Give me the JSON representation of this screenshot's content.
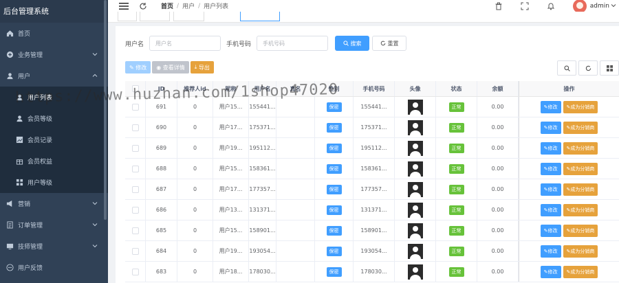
{
  "app": {
    "title": "后台管理系统"
  },
  "sidebar": {
    "items": [
      {
        "label": "首页",
        "icon": "home-icon",
        "expandable": false
      },
      {
        "label": "业务管理",
        "icon": "plus-circle-icon",
        "expandable": true
      },
      {
        "label": "用户",
        "icon": "user-icon",
        "expandable": true,
        "expanded": true
      },
      {
        "label": "用户列表",
        "icon": "user-icon",
        "sub": true,
        "active": true
      },
      {
        "label": "会员等级",
        "icon": "user-icon",
        "sub": true
      },
      {
        "label": "会员记录",
        "icon": "chart-icon",
        "sub": true
      },
      {
        "label": "会员权益",
        "icon": "gift-icon",
        "sub": true
      },
      {
        "label": "用户等级",
        "icon": "grid-icon",
        "sub": true
      },
      {
        "label": "营销",
        "icon": "megaphone-icon",
        "expandable": true
      },
      {
        "label": "订单管理",
        "icon": "order-icon",
        "expandable": true
      },
      {
        "label": "技师管理",
        "icon": "tech-icon",
        "expandable": true
      },
      {
        "label": "用户反馈",
        "icon": "feedback-icon",
        "expandable": false
      }
    ]
  },
  "header": {
    "breadcrumbs": [
      "首页",
      "用户",
      "用户列表"
    ],
    "user": "admin"
  },
  "search": {
    "username_label": "用户名",
    "username_placeholder": "用户名",
    "phone_label": "手机号码",
    "phone_placeholder": "手机号码",
    "search_btn": "搜索",
    "reset_btn": "重置"
  },
  "toolbar": {
    "edit": "修改",
    "details": "查看详情",
    "export": "导出"
  },
  "table": {
    "columns": [
      "ID",
      "推荐人id",
      "昵称",
      "用户名",
      "真名",
      "性别",
      "手机号码",
      "头像",
      "状态",
      "余额",
      "操作"
    ],
    "rows": [
      {
        "id": "691",
        "ref": "0",
        "nick": "用户15...",
        "user": "155441...",
        "name": "",
        "sex": "保密",
        "phone": "155441...",
        "status": "正常",
        "balance": "0.00"
      },
      {
        "id": "690",
        "ref": "0",
        "nick": "用户17...",
        "user": "175371...",
        "name": "",
        "sex": "保密",
        "phone": "175371...",
        "status": "正常",
        "balance": "0.00"
      },
      {
        "id": "689",
        "ref": "0",
        "nick": "用户19...",
        "user": "195112...",
        "name": "",
        "sex": "保密",
        "phone": "195112...",
        "status": "正常",
        "balance": "0.00"
      },
      {
        "id": "688",
        "ref": "0",
        "nick": "用户15...",
        "user": "158361...",
        "name": "",
        "sex": "保密",
        "phone": "158361...",
        "status": "正常",
        "balance": "0.00"
      },
      {
        "id": "687",
        "ref": "0",
        "nick": "用户17...",
        "user": "177357...",
        "name": "",
        "sex": "保密",
        "phone": "177357...",
        "status": "正常",
        "balance": "0.00"
      },
      {
        "id": "686",
        "ref": "0",
        "nick": "用户13...",
        "user": "131371...",
        "name": "",
        "sex": "保密",
        "phone": "131371...",
        "status": "正常",
        "balance": "0.00"
      },
      {
        "id": "685",
        "ref": "0",
        "nick": "用户15...",
        "user": "158901...",
        "name": "",
        "sex": "保密",
        "phone": "158901...",
        "status": "正常",
        "balance": "0.00"
      },
      {
        "id": "684",
        "ref": "0",
        "nick": "用户19...",
        "user": "193054...",
        "name": "",
        "sex": "保密",
        "phone": "193054...",
        "status": "正常",
        "balance": "0.00"
      },
      {
        "id": "683",
        "ref": "0",
        "nick": "用户18...",
        "user": "178030...",
        "name": "",
        "sex": "保密",
        "phone": "178030...",
        "status": "正常",
        "balance": "0.00"
      }
    ],
    "row_actions": {
      "edit": "修改",
      "distributor": "成为分销商"
    }
  },
  "watermark": "https://www.huzhan.com/1shop47020",
  "colors": {
    "sidebar": "#304156",
    "primary": "#409eff",
    "success": "#67c23a",
    "warning": "#e6a23c"
  }
}
